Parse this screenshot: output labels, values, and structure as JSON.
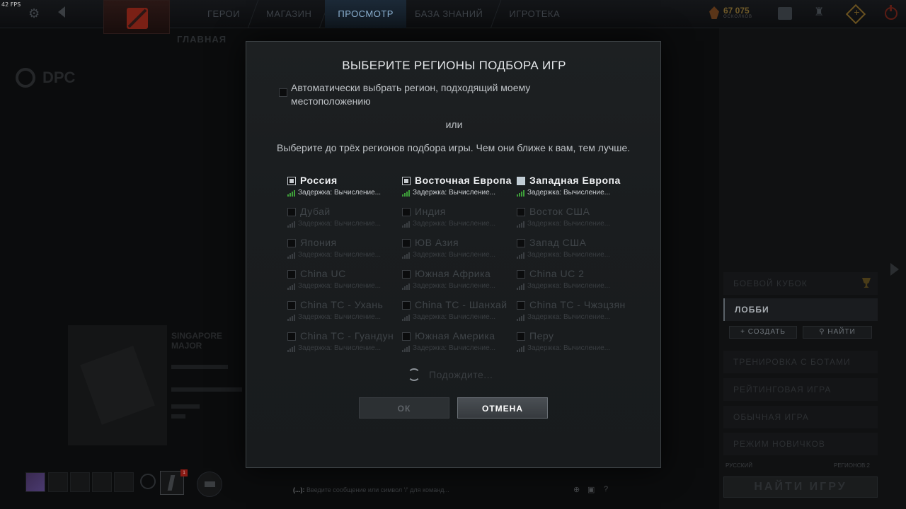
{
  "fps": "42 FPS",
  "nav": {
    "items": [
      {
        "label": "ГЕРОИ",
        "active": false
      },
      {
        "label": "МАГАЗИН",
        "active": false
      },
      {
        "label": "ПРОСМОТР",
        "active": true
      },
      {
        "label": "БАЗА ЗНАНИЙ",
        "active": false
      },
      {
        "label": "ИГРОТЕКА",
        "active": false
      }
    ]
  },
  "shards": {
    "amount": "67 075",
    "label": "ОСКОЛКОВ"
  },
  "background": {
    "subnav": "ГЛАВНАЯ",
    "dpc": "DPC",
    "event_title": "SINGAPORE MAJOR"
  },
  "modal": {
    "title": "ВЫБЕРИТЕ РЕГИОНЫ ПОДБОРА ИГР",
    "auto_label": "Автоматически выбрать регион, подходящий моему местоположению",
    "or": "или",
    "instruction": "Выберите до трёх регионов подбора игры. Чем они ближе к вам, тем лучше.",
    "regions": [
      {
        "name": "Россия",
        "latency": "Задержка: Вычисление...",
        "checked": true
      },
      {
        "name": "Восточная Европа",
        "latency": "Задержка: Вычисление...",
        "checked": true
      },
      {
        "name": "Западная Европа",
        "latency": "Задержка: Вычисление...",
        "checked": true
      },
      {
        "name": "Дубай",
        "latency": "Задержка: Вычисление...",
        "checked": false
      },
      {
        "name": "Индия",
        "latency": "Задержка: Вычисление...",
        "checked": false
      },
      {
        "name": "Восток США",
        "latency": "Задержка: Вычисление...",
        "checked": false
      },
      {
        "name": "Япония",
        "latency": "Задержка: Вычисление...",
        "checked": false
      },
      {
        "name": "ЮВ Азия",
        "latency": "Задержка: Вычисление...",
        "checked": false
      },
      {
        "name": "Запад США",
        "latency": "Задержка: Вычисление...",
        "checked": false
      },
      {
        "name": "China UC",
        "latency": "Задержка: Вычисление...",
        "checked": false
      },
      {
        "name": "Южная Африка",
        "latency": "Задержка: Вычисление...",
        "checked": false
      },
      {
        "name": "China UC 2",
        "latency": "Задержка: Вычисление...",
        "checked": false
      },
      {
        "name": "China TC - Ухань",
        "latency": "Задержка: Вычисление...",
        "checked": false
      },
      {
        "name": "China TC - Шанхай",
        "latency": "Задержка: Вычисление...",
        "checked": false
      },
      {
        "name": "China TC - Чжэцзян",
        "latency": "Задержка: Вычисление...",
        "checked": false
      },
      {
        "name": "China TC - Гуандун",
        "latency": "Задержка: Вычисление...",
        "checked": false
      },
      {
        "name": "Южная Америка",
        "latency": "Задержка: Вычисление...",
        "checked": false
      },
      {
        "name": "Перу",
        "latency": "Задержка: Вычисление...",
        "checked": false
      }
    ],
    "wait": "Подождите...",
    "ok": "ОК",
    "cancel": "ОТМЕНА"
  },
  "right_panel": {
    "battle_cup": "БОЕВОЙ КУБОК",
    "lobby": "ЛОББИ",
    "create": "+ СОЗДАТЬ",
    "find": "НАЙТИ",
    "bots": "ТРЕНИРОВКА С БОТАМИ",
    "ranked": "РЕЙТИНГОВАЯ ИГРА",
    "normal": "ОБЫЧНАЯ ИГРА",
    "newbie": "РЕЖИМ НОВИЧКОВ",
    "language": "РУССКИЙ",
    "regions": "РЕГИОНОВ:2",
    "find_game": "НАЙТИ ИГРУ"
  },
  "bottom": {
    "battlepass_badge": "1",
    "chat_prefix": "(...):",
    "chat_placeholder": "Введите сообщение или символ '/' для команд..."
  },
  "colors": {
    "accent_active_tab": "#8fb5d6",
    "latency_green": "#3ea03a",
    "modal_bg": "#1a1d1f"
  }
}
